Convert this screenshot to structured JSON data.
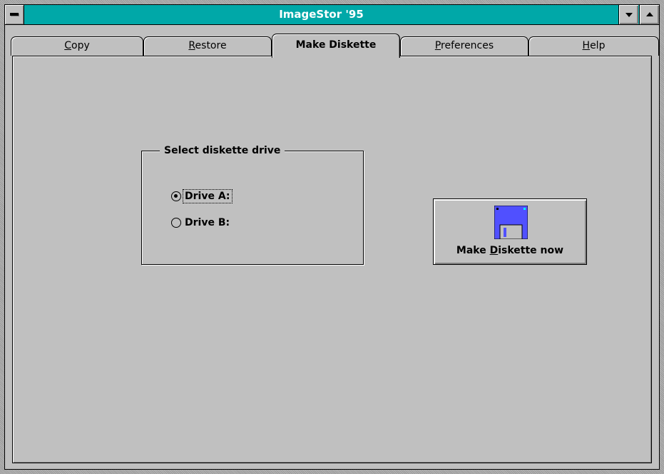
{
  "window": {
    "title": "ImageStor '95"
  },
  "titlebar": {
    "system_menu_icon": "system-menu-icon",
    "minimize_icon": "minimize-arrow-icon",
    "maximize_icon": "maximize-arrow-icon"
  },
  "tabs": [
    {
      "label_pre": "",
      "label_mnemonic": "C",
      "label_post": "opy",
      "active": false
    },
    {
      "label_pre": "",
      "label_mnemonic": "R",
      "label_post": "estore",
      "active": false
    },
    {
      "label_pre": "Make Diskette",
      "label_mnemonic": "",
      "label_post": "",
      "active": true
    },
    {
      "label_pre": "",
      "label_mnemonic": "P",
      "label_post": "references",
      "active": false
    },
    {
      "label_pre": "",
      "label_mnemonic": "H",
      "label_post": "elp",
      "active": false
    }
  ],
  "drive_group": {
    "legend": "Select diskette drive",
    "options": [
      {
        "label": "Drive A:",
        "checked": true
      },
      {
        "label": "Drive B:",
        "checked": false
      }
    ]
  },
  "make_button": {
    "label_pre": "Make ",
    "label_mnemonic": "D",
    "label_post": "iskette now",
    "icon": "floppy-disk-icon"
  },
  "colors": {
    "titlebar": "#00a8a8",
    "face": "#c0c0c0",
    "floppy_body": "#5050ff"
  }
}
